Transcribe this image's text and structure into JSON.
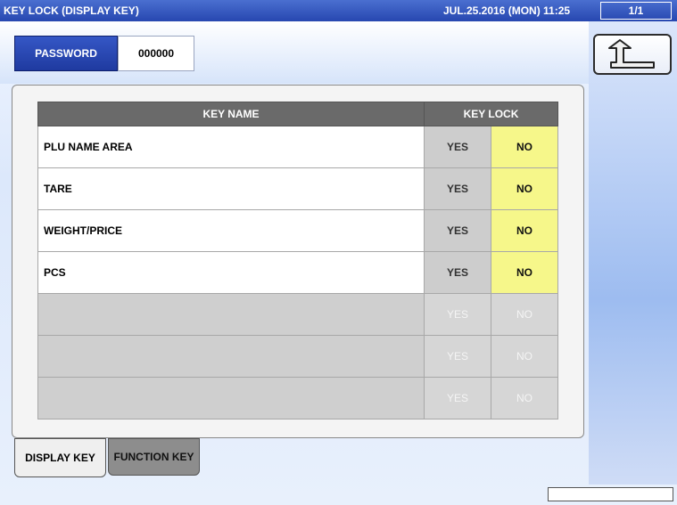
{
  "window": {
    "title": "KEY LOCK (DISPLAY KEY)",
    "datetime": "JUL.25.2016 (MON)  11:25",
    "page": "1/1"
  },
  "password": {
    "label": "PASSWORD",
    "value": "000000"
  },
  "back_button": {
    "icon": "return-arrow-icon"
  },
  "table": {
    "headers": {
      "key_name": "KEY NAME",
      "key_lock": "KEY LOCK"
    },
    "rows": [
      {
        "name": "PLU NAME AREA",
        "yes": "YES",
        "no": "NO",
        "selected": "NO"
      },
      {
        "name": "TARE",
        "yes": "YES",
        "no": "NO",
        "selected": "NO"
      },
      {
        "name": "WEIGHT/PRICE",
        "yes": "YES",
        "no": "NO",
        "selected": "NO"
      },
      {
        "name": "PCS",
        "yes": "YES",
        "no": "NO",
        "selected": "NO"
      },
      {
        "name": "",
        "yes": "YES",
        "no": "NO",
        "disabled": true
      },
      {
        "name": "",
        "yes": "YES",
        "no": "NO",
        "disabled": true
      },
      {
        "name": "",
        "yes": "YES",
        "no": "NO",
        "disabled": true
      }
    ]
  },
  "tabs": [
    {
      "label": "DISPLAY KEY",
      "active": true
    },
    {
      "label": "FUNCTION KEY",
      "active": false
    }
  ],
  "colors": {
    "titlebar": "#2747b0",
    "selected_no": "#f6f78a",
    "header": "#6a6a6a"
  }
}
